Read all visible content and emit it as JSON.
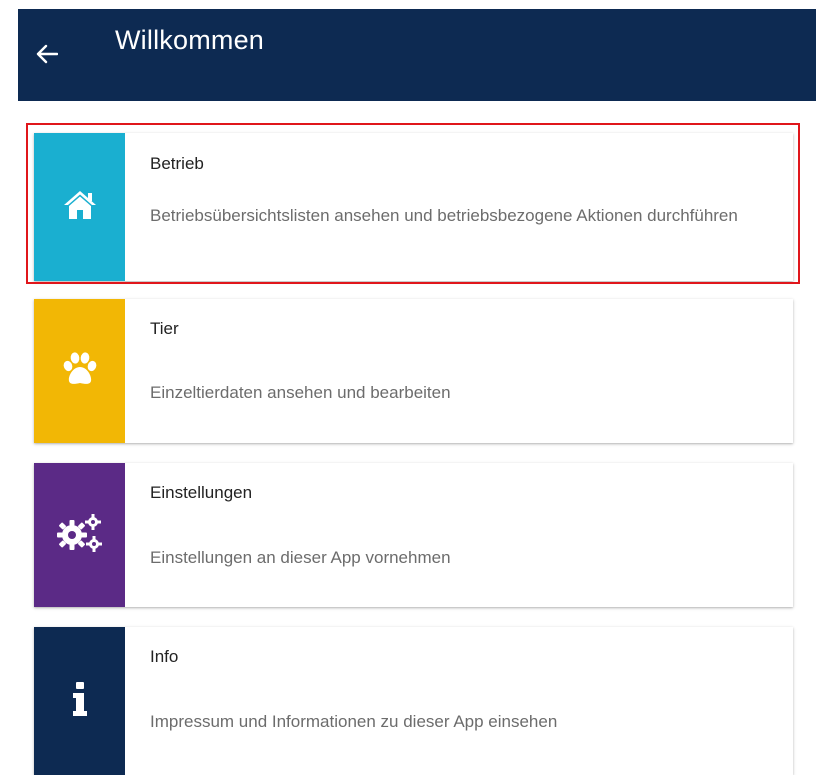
{
  "header": {
    "title": "Willkommen",
    "background": "#0d2a52",
    "back_icon": "arrow-left-icon"
  },
  "cards": [
    {
      "title": "Betrieb",
      "description": "Betriebsübersichtslisten ansehen und betriebsbezogene Aktionen durchführen",
      "color": "#1aafd0",
      "icon": "home-icon",
      "selected": true
    },
    {
      "title": "Tier",
      "description": "Einzeltierdaten ansehen und bearbeiten",
      "color": "#f2b705",
      "icon": "paw-icon",
      "selected": false
    },
    {
      "title": "Einstellungen",
      "description": "Einstellungen an dieser App vornehmen",
      "color": "#5b2a86",
      "icon": "gears-icon",
      "selected": false
    },
    {
      "title": "Info",
      "description": "Impressum und Informationen zu dieser App einsehen",
      "color": "#0d2a52",
      "icon": "info-icon",
      "selected": false
    }
  ],
  "selection_color": "#e0161b"
}
